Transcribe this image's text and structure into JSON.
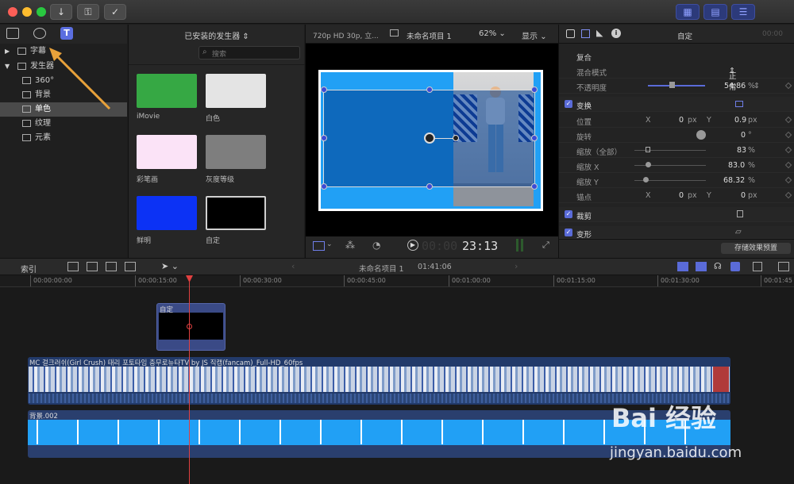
{
  "toolbar": {
    "import_icon": "download-arrow-icon",
    "keywords_icon": "key-icon",
    "check_icon": "checkmark-circle-icon",
    "right_buttons": [
      "browser-layout-icon",
      "timeline-layout-icon",
      "inspector-sliders-icon"
    ]
  },
  "library": {
    "items": [
      {
        "label": "字幕",
        "level": 0,
        "expanded": false
      },
      {
        "label": "发生器",
        "level": 0,
        "expanded": true
      },
      {
        "label": "360°",
        "level": 1
      },
      {
        "label": "背景",
        "level": 1
      },
      {
        "label": "单色",
        "level": 1,
        "selected": true
      },
      {
        "label": "纹理",
        "level": 1
      },
      {
        "label": "元素",
        "level": 1
      }
    ]
  },
  "browser": {
    "header": "已安装的发生器",
    "search_placeholder": "搜索",
    "items": [
      {
        "label": "iMovie",
        "color": "#36a844"
      },
      {
        "label": "白色",
        "color": "#e4e4e4"
      },
      {
        "label": "彩笔画",
        "color": "#fbe3f7"
      },
      {
        "label": "灰度等级",
        "color": "#7e7e7e"
      },
      {
        "label": "鲜明",
        "color": "#0c32f5"
      },
      {
        "label": "自定",
        "color": "#000000"
      }
    ]
  },
  "viewer": {
    "format": "720p HD 30p, 立...",
    "project": "未命名项目 1",
    "zoom": "62%",
    "view_menu": "显示",
    "timecode_dim": "00:00",
    "timecode": "23:13"
  },
  "inspector": {
    "title": "自定",
    "timecode": "00:00",
    "section_composite": "复合",
    "blend_mode_label": "混合模式",
    "blend_mode_value": "正常",
    "opacity_label": "不透明度",
    "opacity_value": "54.86",
    "opacity_unit": "%",
    "transform_label": "变换",
    "position_label": "位置",
    "position_x_label": "X",
    "position_x": "0",
    "position_y_label": "Y",
    "position_y": "0.9",
    "px": "px",
    "rotation_label": "旋转",
    "rotation_value": "0",
    "deg": "°",
    "scale_all_label": "缩放（全部）",
    "scale_all": "83",
    "scale_x_label": "缩放 X",
    "scale_x": "83.0",
    "scale_y_label": "缩放 Y",
    "scale_y": "68.32",
    "anchor_label": "锚点",
    "anchor_x": "0",
    "anchor_y": "0",
    "crop_label": "裁剪",
    "distort_label": "变形",
    "save_preset": "存储效果预置"
  },
  "timeline_toolbar": {
    "index": "索引",
    "project": "未命名项目 1",
    "duration": "01:41:06"
  },
  "ruler": [
    "00:00:00:00",
    "00:00:15:00",
    "00:00:30:00",
    "00:00:45:00",
    "00:01:00:00",
    "00:01:15:00",
    "00:01:30:00",
    "00:01:45"
  ],
  "clips": {
    "generator": "自定",
    "video": "MC 걸크러쉬(Girl Crush) 태리 포토타임 충무로뉴타TV by JS 직캠(fancam)_Full-HD_60fps",
    "background": "背景.002"
  },
  "watermark": {
    "logo": "Bai 经验",
    "url": "jingyan.baidu.com"
  }
}
